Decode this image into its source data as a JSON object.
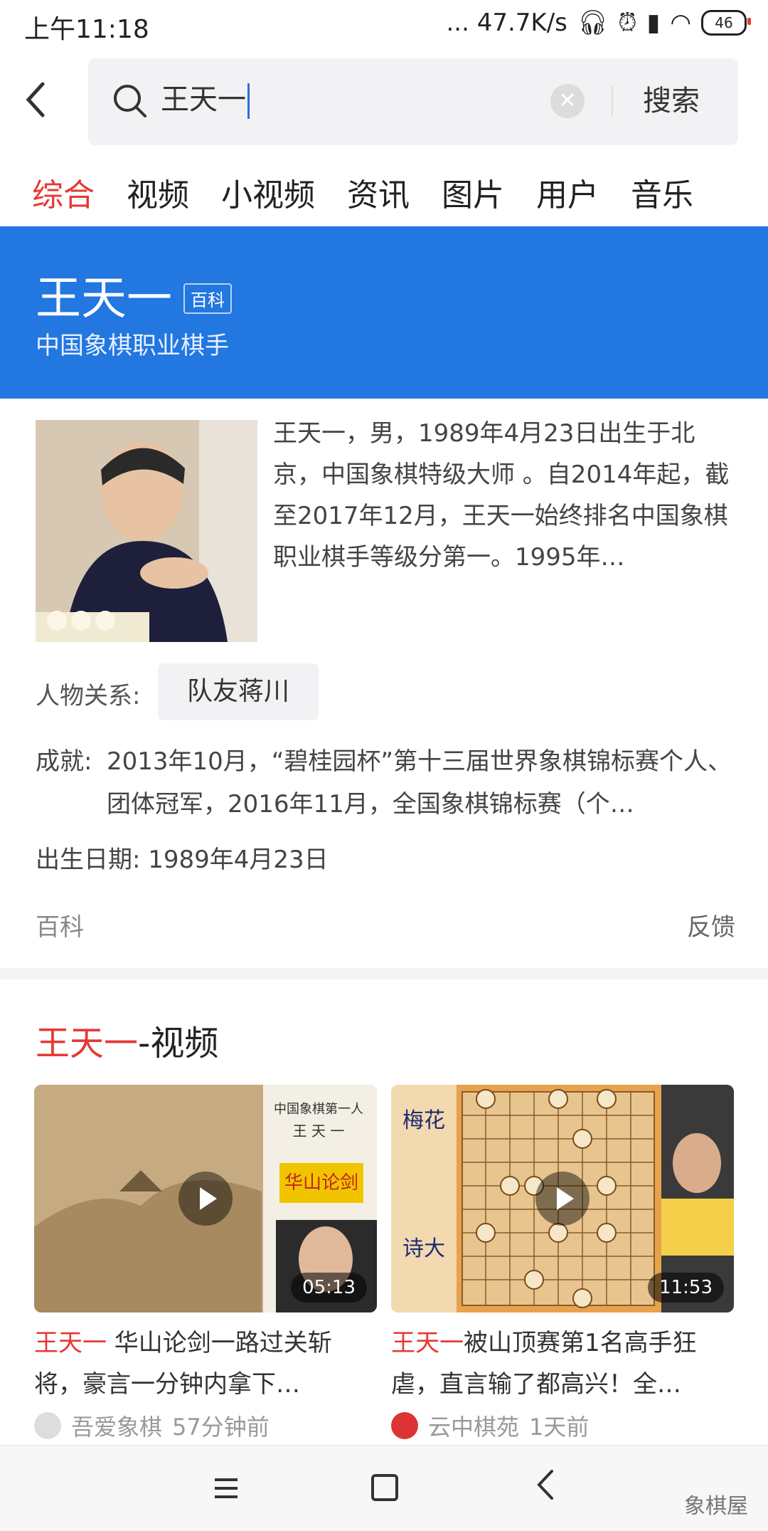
{
  "status_bar": {
    "time": "上午11:18",
    "network_speed": "... 47.7K/s",
    "battery": "46"
  },
  "search": {
    "query": "王天一",
    "button_label": "搜索"
  },
  "tabs": [
    "综合",
    "视频",
    "小视频",
    "资讯",
    "图片",
    "用户",
    "音乐"
  ],
  "baike": {
    "title": "王天一",
    "badge": "百科",
    "subtitle": "中国象棋职业棋手",
    "summary": "王天一，男，1989年4月23日出生于北京，中国象棋特级大师 。自2014年起，截至2017年12月，王天一始终排名中国象棋职业棋手等级分第一。1995年…",
    "relation_label": "人物关系:",
    "relation_chip": "队友蒋川",
    "achievement_label": "成就:",
    "achievement_text": "2013年10月，“碧桂园杯”第十三届世界象棋锦标赛个人、团体冠军，2016年11月，全国象棋锦标赛（个…",
    "birth": "出生日期: 1989年4月23日",
    "footer_left": "百科",
    "footer_right": "反馈"
  },
  "videos": {
    "title_highlight": "王天一",
    "title_rest": "-视频",
    "items": [
      {
        "duration": "05:13",
        "title_highlight": "王天一",
        "title_rest": " 华山论剑一路过关斩将，豪言一分钟内拿下…",
        "author": "吾爱象棋",
        "time": "57分钟前"
      },
      {
        "duration": "11:53",
        "title_highlight": "王天一",
        "title_rest": "被山顶赛第1名高手狂虐，直言输了都高兴！全…",
        "author": "云中棋苑",
        "time": "1天前"
      }
    ]
  },
  "nav": {
    "watermark": "象棋屋"
  },
  "colors": {
    "accent": "#e53935",
    "baike_blue": "#2277e0"
  }
}
